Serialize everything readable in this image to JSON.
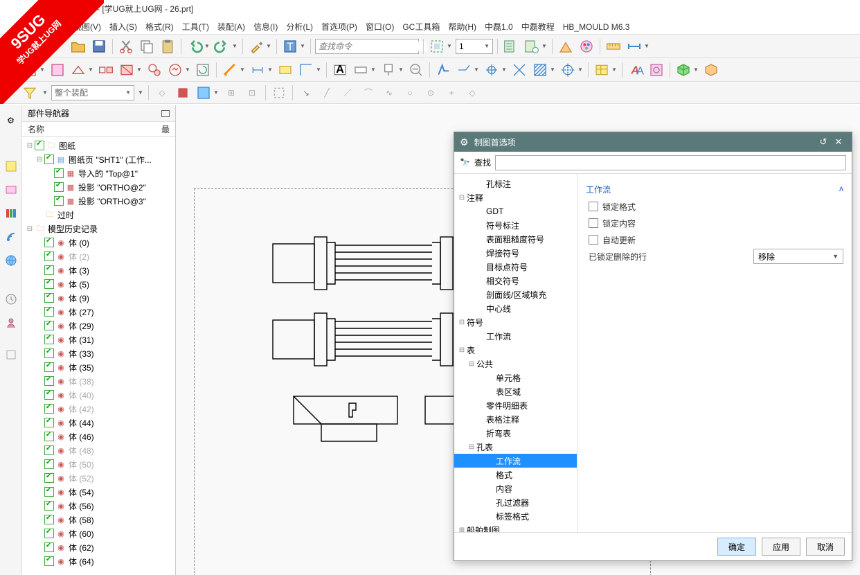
{
  "title": "- [学UG就上UG网 - 26.prt]",
  "watermark": {
    "line1": "9SUG",
    "line2": "学UG就上UG网"
  },
  "menu": [
    "视图(V)",
    "插入(S)",
    "格式(R)",
    "工具(T)",
    "装配(A)",
    "信息(I)",
    "分析(L)",
    "首选项(P)",
    "窗口(O)",
    "GC工具箱",
    "帮助(H)",
    "中磊1.0",
    "中磊教程",
    "HB_MOULD M6.3"
  ],
  "toolbar": {
    "search_placeholder": "查找命令",
    "num_value": "1",
    "assembly_scope": "整个装配"
  },
  "nav": {
    "title": "部件导航器",
    "col_name": "名称",
    "col_new": "最",
    "root": "图纸",
    "sheet": "图纸页 \"SHT1\" (工作...",
    "views": [
      "导入的 \"Top@1\"",
      "投影 \"ORTHO@2\"",
      "投影 \"ORTHO@3\""
    ],
    "outdated": "过时",
    "history": "模型历史记录",
    "bodies": [
      {
        "label": "体 (0)",
        "dim": false
      },
      {
        "label": "体 (2)",
        "dim": true
      },
      {
        "label": "体 (3)",
        "dim": false
      },
      {
        "label": "体 (5)",
        "dim": false
      },
      {
        "label": "体 (9)",
        "dim": false
      },
      {
        "label": "体 (27)",
        "dim": false
      },
      {
        "label": "体 (29)",
        "dim": false
      },
      {
        "label": "体 (31)",
        "dim": false
      },
      {
        "label": "体 (33)",
        "dim": false
      },
      {
        "label": "体 (35)",
        "dim": false
      },
      {
        "label": "体 (38)",
        "dim": true
      },
      {
        "label": "体 (40)",
        "dim": true
      },
      {
        "label": "体 (42)",
        "dim": true
      },
      {
        "label": "体 (44)",
        "dim": false
      },
      {
        "label": "体 (46)",
        "dim": false
      },
      {
        "label": "体 (48)",
        "dim": true
      },
      {
        "label": "体 (50)",
        "dim": true
      },
      {
        "label": "体 (52)",
        "dim": true
      },
      {
        "label": "体 (54)",
        "dim": false
      },
      {
        "label": "体 (56)",
        "dim": false
      },
      {
        "label": "体 (58)",
        "dim": false
      },
      {
        "label": "体 (60)",
        "dim": false
      },
      {
        "label": "体 (62)",
        "dim": false
      },
      {
        "label": "体 (64)",
        "dim": false
      }
    ]
  },
  "dialog": {
    "title": "制图首选项",
    "find_label": "查找",
    "find_value": "",
    "tree": [
      {
        "d": 2,
        "t": "",
        "l": "孔标注"
      },
      {
        "d": 0,
        "t": "-",
        "l": "注释"
      },
      {
        "d": 2,
        "t": "",
        "l": "GDT"
      },
      {
        "d": 2,
        "t": "",
        "l": "符号标注"
      },
      {
        "d": 2,
        "t": "",
        "l": "表面粗糙度符号"
      },
      {
        "d": 2,
        "t": "",
        "l": "焊接符号"
      },
      {
        "d": 2,
        "t": "",
        "l": "目标点符号"
      },
      {
        "d": 2,
        "t": "",
        "l": "相交符号"
      },
      {
        "d": 2,
        "t": "",
        "l": "剖面线/区域填充"
      },
      {
        "d": 2,
        "t": "",
        "l": "中心线"
      },
      {
        "d": 0,
        "t": "-",
        "l": "符号"
      },
      {
        "d": 2,
        "t": "",
        "l": "工作流"
      },
      {
        "d": 0,
        "t": "-",
        "l": "表"
      },
      {
        "d": 1,
        "t": "-",
        "l": "公共"
      },
      {
        "d": 3,
        "t": "",
        "l": "单元格"
      },
      {
        "d": 3,
        "t": "",
        "l": "表区域"
      },
      {
        "d": 2,
        "t": "",
        "l": "零件明细表"
      },
      {
        "d": 2,
        "t": "",
        "l": "表格注释"
      },
      {
        "d": 2,
        "t": "",
        "l": "折弯表"
      },
      {
        "d": 1,
        "t": "-",
        "l": "孔表"
      },
      {
        "d": 3,
        "t": "",
        "l": "工作流",
        "sel": true
      },
      {
        "d": 3,
        "t": "",
        "l": "格式"
      },
      {
        "d": 3,
        "t": "",
        "l": "内容"
      },
      {
        "d": 3,
        "t": "",
        "l": "孔过滤器"
      },
      {
        "d": 3,
        "t": "",
        "l": "标签格式"
      },
      {
        "d": 0,
        "t": "+",
        "l": "船舶制图"
      }
    ],
    "right": {
      "section": "工作流",
      "lock_format": "锁定格式",
      "lock_content": "锁定内容",
      "auto_update": "自动更新",
      "deleted_rows_label": "已锁定删除的行",
      "deleted_rows_value": "移除"
    },
    "btn_ok": "确定",
    "btn_apply": "应用",
    "btn_cancel": "取消"
  }
}
